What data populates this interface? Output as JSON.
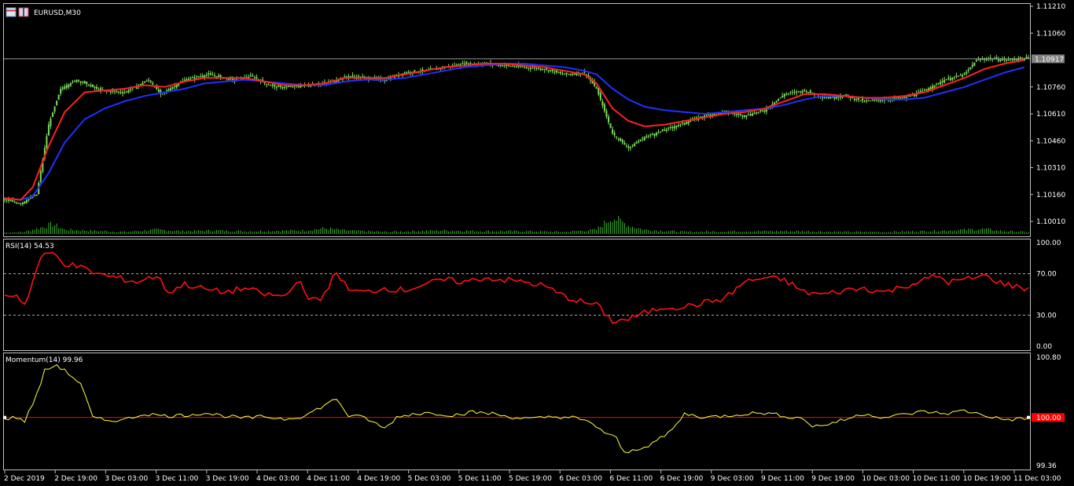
{
  "window": {
    "symbol_title": "EURUSD,M30"
  },
  "colors": {
    "background": "#000000",
    "frame": "#c0c0c0",
    "candle": "#7cdc5c",
    "ma_fast": "#ff2020",
    "ma_slow": "#2030ff",
    "volume": "#3fae2f",
    "rsi_line": "#ff1010",
    "momentum_line": "#ffff40",
    "momentum_level": "#ff0000",
    "last_price_bg": "#808080"
  },
  "chart_data": [
    {
      "type": "candlestick",
      "title": "EURUSD,M30",
      "price_ticks": [
        "1.11210",
        "1.11060",
        "1.10917",
        "1.10760",
        "1.10610",
        "1.10460",
        "1.10310",
        "1.10160",
        "1.10010"
      ],
      "last_price": "1.10917",
      "ylim": [
        1.0994,
        1.1121
      ],
      "x_time_labels": [
        "2 Dec 2019",
        "2 Dec 19:00",
        "3 Dec 03:00",
        "3 Dec 11:00",
        "3 Dec 19:00",
        "4 Dec 03:00",
        "4 Dec 11:00",
        "4 Dec 19:00",
        "5 Dec 03:00",
        "5 Dec 11:00",
        "5 Dec 19:00",
        "6 Dec 03:00",
        "6 Dec 11:00",
        "6 Dec 19:00",
        "9 Dec 03:00",
        "9 Dec 11:00",
        "9 Dec 19:00",
        "10 Dec 03:00",
        "10 Dec 11:00",
        "10 Dec 19:00",
        "11 Dec 03:00"
      ],
      "close_path": [
        [
          0,
          1.1013
        ],
        [
          8,
          1.1011
        ],
        [
          16,
          1.1016
        ],
        [
          22,
          1.1055
        ],
        [
          28,
          1.1075
        ],
        [
          36,
          1.108
        ],
        [
          48,
          1.1074
        ],
        [
          60,
          1.1073
        ],
        [
          72,
          1.108
        ],
        [
          78,
          1.1072
        ],
        [
          90,
          1.108
        ],
        [
          102,
          1.1083
        ],
        [
          114,
          1.108
        ],
        [
          124,
          1.1082
        ],
        [
          130,
          1.1078
        ],
        [
          136,
          1.1076
        ],
        [
          142,
          1.1076
        ],
        [
          152,
          1.1077
        ],
        [
          160,
          1.1078
        ],
        [
          166,
          1.108
        ],
        [
          172,
          1.1082
        ],
        [
          180,
          1.1081
        ],
        [
          190,
          1.108
        ],
        [
          200,
          1.1084
        ],
        [
          210,
          1.1085
        ],
        [
          220,
          1.1087
        ],
        [
          230,
          1.1089
        ],
        [
          240,
          1.1089
        ],
        [
          250,
          1.1088
        ],
        [
          260,
          1.1087
        ],
        [
          270,
          1.1086
        ],
        [
          280,
          1.1083
        ],
        [
          290,
          1.1084
        ],
        [
          296,
          1.1075
        ],
        [
          304,
          1.105
        ],
        [
          312,
          1.1042
        ],
        [
          320,
          1.1048
        ],
        [
          330,
          1.1052
        ],
        [
          340,
          1.1056
        ],
        [
          350,
          1.106
        ],
        [
          360,
          1.1062
        ],
        [
          370,
          1.106
        ],
        [
          380,
          1.1063
        ],
        [
          390,
          1.1072
        ],
        [
          400,
          1.1074
        ],
        [
          410,
          1.107
        ],
        [
          420,
          1.1071
        ],
        [
          430,
          1.1068
        ],
        [
          440,
          1.1069
        ],
        [
          450,
          1.107
        ],
        [
          460,
          1.1074
        ],
        [
          470,
          1.108
        ],
        [
          480,
          1.1083
        ],
        [
          486,
          1.1091
        ],
        [
          492,
          1.1092
        ],
        [
          500,
          1.1091
        ],
        [
          510,
          1.1092
        ]
      ],
      "volume_path": [
        [
          0,
          2
        ],
        [
          10,
          3
        ],
        [
          18,
          9
        ],
        [
          24,
          14
        ],
        [
          30,
          6
        ],
        [
          60,
          3
        ],
        [
          76,
          6
        ],
        [
          90,
          4
        ],
        [
          104,
          5
        ],
        [
          120,
          4
        ],
        [
          150,
          5
        ],
        [
          160,
          8
        ],
        [
          170,
          5
        ],
        [
          190,
          3
        ],
        [
          205,
          4
        ],
        [
          220,
          5
        ],
        [
          240,
          4
        ],
        [
          260,
          4
        ],
        [
          280,
          3
        ],
        [
          296,
          6
        ],
        [
          304,
          24
        ],
        [
          312,
          12
        ],
        [
          320,
          6
        ],
        [
          340,
          3
        ],
        [
          370,
          4
        ],
        [
          400,
          4
        ],
        [
          420,
          3
        ],
        [
          440,
          3
        ],
        [
          460,
          4
        ],
        [
          480,
          6
        ],
        [
          490,
          7
        ],
        [
          500,
          4
        ],
        [
          510,
          3
        ]
      ],
      "ma_fast_path": [
        [
          0,
          1.1014
        ],
        [
          8,
          1.1013
        ],
        [
          14,
          1.102
        ],
        [
          22,
          1.1043
        ],
        [
          30,
          1.1062
        ],
        [
          40,
          1.1073
        ],
        [
          50,
          1.1074
        ],
        [
          60,
          1.1075
        ],
        [
          70,
          1.1077
        ],
        [
          80,
          1.1076
        ],
        [
          90,
          1.1079
        ],
        [
          100,
          1.1081
        ],
        [
          110,
          1.1081
        ],
        [
          120,
          1.1081
        ],
        [
          130,
          1.1079
        ],
        [
          140,
          1.1077
        ],
        [
          150,
          1.1077
        ],
        [
          160,
          1.1078
        ],
        [
          170,
          1.1081
        ],
        [
          180,
          1.1081
        ],
        [
          190,
          1.1081
        ],
        [
          200,
          1.1083
        ],
        [
          210,
          1.1085
        ],
        [
          220,
          1.1087
        ],
        [
          230,
          1.1088
        ],
        [
          240,
          1.1089
        ],
        [
          250,
          1.1089
        ],
        [
          260,
          1.1088
        ],
        [
          270,
          1.1087
        ],
        [
          280,
          1.1085
        ],
        [
          290,
          1.1083
        ],
        [
          296,
          1.1078
        ],
        [
          304,
          1.1064
        ],
        [
          312,
          1.1057
        ],
        [
          320,
          1.1054
        ],
        [
          330,
          1.1055
        ],
        [
          340,
          1.1057
        ],
        [
          350,
          1.1059
        ],
        [
          360,
          1.1061
        ],
        [
          370,
          1.1062
        ],
        [
          380,
          1.1064
        ],
        [
          390,
          1.1068
        ],
        [
          400,
          1.1072
        ],
        [
          410,
          1.1072
        ],
        [
          420,
          1.1071
        ],
        [
          430,
          1.107
        ],
        [
          440,
          1.107
        ],
        [
          450,
          1.1071
        ],
        [
          460,
          1.1073
        ],
        [
          470,
          1.1077
        ],
        [
          480,
          1.1081
        ],
        [
          490,
          1.1086
        ],
        [
          500,
          1.1089
        ],
        [
          510,
          1.1091
        ]
      ],
      "ma_slow_path": [
        [
          0,
          1.1014
        ],
        [
          8,
          1.1013
        ],
        [
          14,
          1.1015
        ],
        [
          22,
          1.1028
        ],
        [
          30,
          1.1045
        ],
        [
          40,
          1.1058
        ],
        [
          50,
          1.1064
        ],
        [
          60,
          1.1068
        ],
        [
          70,
          1.1071
        ],
        [
          80,
          1.1073
        ],
        [
          90,
          1.1075
        ],
        [
          100,
          1.1078
        ],
        [
          110,
          1.1079
        ],
        [
          120,
          1.108
        ],
        [
          130,
          1.1079
        ],
        [
          140,
          1.1078
        ],
        [
          150,
          1.1077
        ],
        [
          160,
          1.1077
        ],
        [
          170,
          1.1079
        ],
        [
          180,
          1.108
        ],
        [
          190,
          1.108
        ],
        [
          200,
          1.1081
        ],
        [
          210,
          1.1083
        ],
        [
          220,
          1.1085
        ],
        [
          230,
          1.1087
        ],
        [
          240,
          1.1088
        ],
        [
          250,
          1.1089
        ],
        [
          260,
          1.1089
        ],
        [
          270,
          1.1088
        ],
        [
          280,
          1.1087
        ],
        [
          290,
          1.1085
        ],
        [
          296,
          1.1083
        ],
        [
          304,
          1.1075
        ],
        [
          312,
          1.1069
        ],
        [
          320,
          1.1065
        ],
        [
          330,
          1.1063
        ],
        [
          340,
          1.1062
        ],
        [
          350,
          1.1061
        ],
        [
          360,
          1.1062
        ],
        [
          370,
          1.1063
        ],
        [
          380,
          1.1064
        ],
        [
          390,
          1.1066
        ],
        [
          400,
          1.1069
        ],
        [
          410,
          1.1071
        ],
        [
          420,
          1.1071
        ],
        [
          430,
          1.107
        ],
        [
          440,
          1.1069
        ],
        [
          450,
          1.1069
        ],
        [
          460,
          1.107
        ],
        [
          470,
          1.1073
        ],
        [
          480,
          1.1076
        ],
        [
          490,
          1.108
        ],
        [
          500,
          1.1084
        ],
        [
          510,
          1.1087
        ]
      ],
      "x_index_max": 512
    },
    {
      "type": "line",
      "title": "RSI(14) 54.53",
      "ticks": [
        "100.00",
        "70.00",
        "30.00",
        "0.00"
      ],
      "levels": [
        70,
        30
      ],
      "ylim": [
        0,
        100
      ],
      "path": [
        [
          0,
          48
        ],
        [
          6,
          50
        ],
        [
          10,
          40
        ],
        [
          14,
          62
        ],
        [
          18,
          86
        ],
        [
          24,
          90
        ],
        [
          30,
          80
        ],
        [
          38,
          76
        ],
        [
          46,
          70
        ],
        [
          56,
          66
        ],
        [
          66,
          62
        ],
        [
          76,
          68
        ],
        [
          82,
          52
        ],
        [
          90,
          60
        ],
        [
          100,
          55
        ],
        [
          110,
          52
        ],
        [
          120,
          56
        ],
        [
          130,
          50
        ],
        [
          140,
          48
        ],
        [
          148,
          65
        ],
        [
          152,
          44
        ],
        [
          158,
          45
        ],
        [
          166,
          72
        ],
        [
          172,
          54
        ],
        [
          180,
          52
        ],
        [
          190,
          56
        ],
        [
          200,
          54
        ],
        [
          210,
          60
        ],
        [
          220,
          64
        ],
        [
          230,
          62
        ],
        [
          240,
          66
        ],
        [
          250,
          64
        ],
        [
          260,
          62
        ],
        [
          270,
          58
        ],
        [
          280,
          48
        ],
        [
          290,
          42
        ],
        [
          296,
          40
        ],
        [
          304,
          24
        ],
        [
          312,
          26
        ],
        [
          320,
          32
        ],
        [
          330,
          38
        ],
        [
          340,
          38
        ],
        [
          350,
          42
        ],
        [
          360,
          46
        ],
        [
          370,
          62
        ],
        [
          380,
          66
        ],
        [
          390,
          64
        ],
        [
          400,
          52
        ],
        [
          410,
          50
        ],
        [
          420,
          54
        ],
        [
          430,
          56
        ],
        [
          440,
          52
        ],
        [
          450,
          58
        ],
        [
          460,
          64
        ],
        [
          466,
          68
        ],
        [
          472,
          62
        ],
        [
          480,
          64
        ],
        [
          490,
          68
        ],
        [
          500,
          60
        ],
        [
          510,
          56
        ]
      ]
    },
    {
      "type": "line",
      "title": "Momentum(14) 99.96",
      "ticks": [
        "100.80",
        "100.00",
        "99.36"
      ],
      "current_value": "100.00",
      "level": 100,
      "ylim": [
        99.36,
        100.8
      ],
      "path": [
        [
          0,
          99.98
        ],
        [
          6,
          100.0
        ],
        [
          10,
          99.95
        ],
        [
          16,
          100.3
        ],
        [
          20,
          100.62
        ],
        [
          26,
          100.7
        ],
        [
          32,
          100.58
        ],
        [
          38,
          100.45
        ],
        [
          44,
          100.0
        ],
        [
          50,
          99.96
        ],
        [
          60,
          99.97
        ],
        [
          70,
          100.05
        ],
        [
          80,
          100.02
        ],
        [
          90,
          100.03
        ],
        [
          100,
          100.06
        ],
        [
          110,
          100.02
        ],
        [
          120,
          99.99
        ],
        [
          130,
          100.01
        ],
        [
          140,
          99.98
        ],
        [
          150,
          100.02
        ],
        [
          166,
          100.25
        ],
        [
          172,
          100.02
        ],
        [
          180,
          100.0
        ],
        [
          190,
          99.85
        ],
        [
          196,
          100.0
        ],
        [
          204,
          100.05
        ],
        [
          214,
          100.06
        ],
        [
          224,
          100.03
        ],
        [
          234,
          100.07
        ],
        [
          244,
          100.05
        ],
        [
          254,
          100.0
        ],
        [
          264,
          99.98
        ],
        [
          274,
          100.01
        ],
        [
          284,
          100.0
        ],
        [
          294,
          99.92
        ],
        [
          300,
          99.8
        ],
        [
          306,
          99.72
        ],
        [
          310,
          99.52
        ],
        [
          316,
          99.58
        ],
        [
          322,
          99.63
        ],
        [
          330,
          99.75
        ],
        [
          336,
          99.9
        ],
        [
          340,
          100.05
        ],
        [
          350,
          100.0
        ],
        [
          360,
          100.02
        ],
        [
          370,
          100.05
        ],
        [
          380,
          100.06
        ],
        [
          390,
          100.02
        ],
        [
          400,
          99.98
        ],
        [
          404,
          99.88
        ],
        [
          410,
          99.9
        ],
        [
          420,
          99.97
        ],
        [
          430,
          100.05
        ],
        [
          440,
          100.0
        ],
        [
          450,
          100.04
        ],
        [
          460,
          100.08
        ],
        [
          470,
          100.05
        ],
        [
          480,
          100.09
        ],
        [
          490,
          100.03
        ],
        [
          500,
          99.97
        ],
        [
          510,
          99.98
        ]
      ]
    }
  ]
}
